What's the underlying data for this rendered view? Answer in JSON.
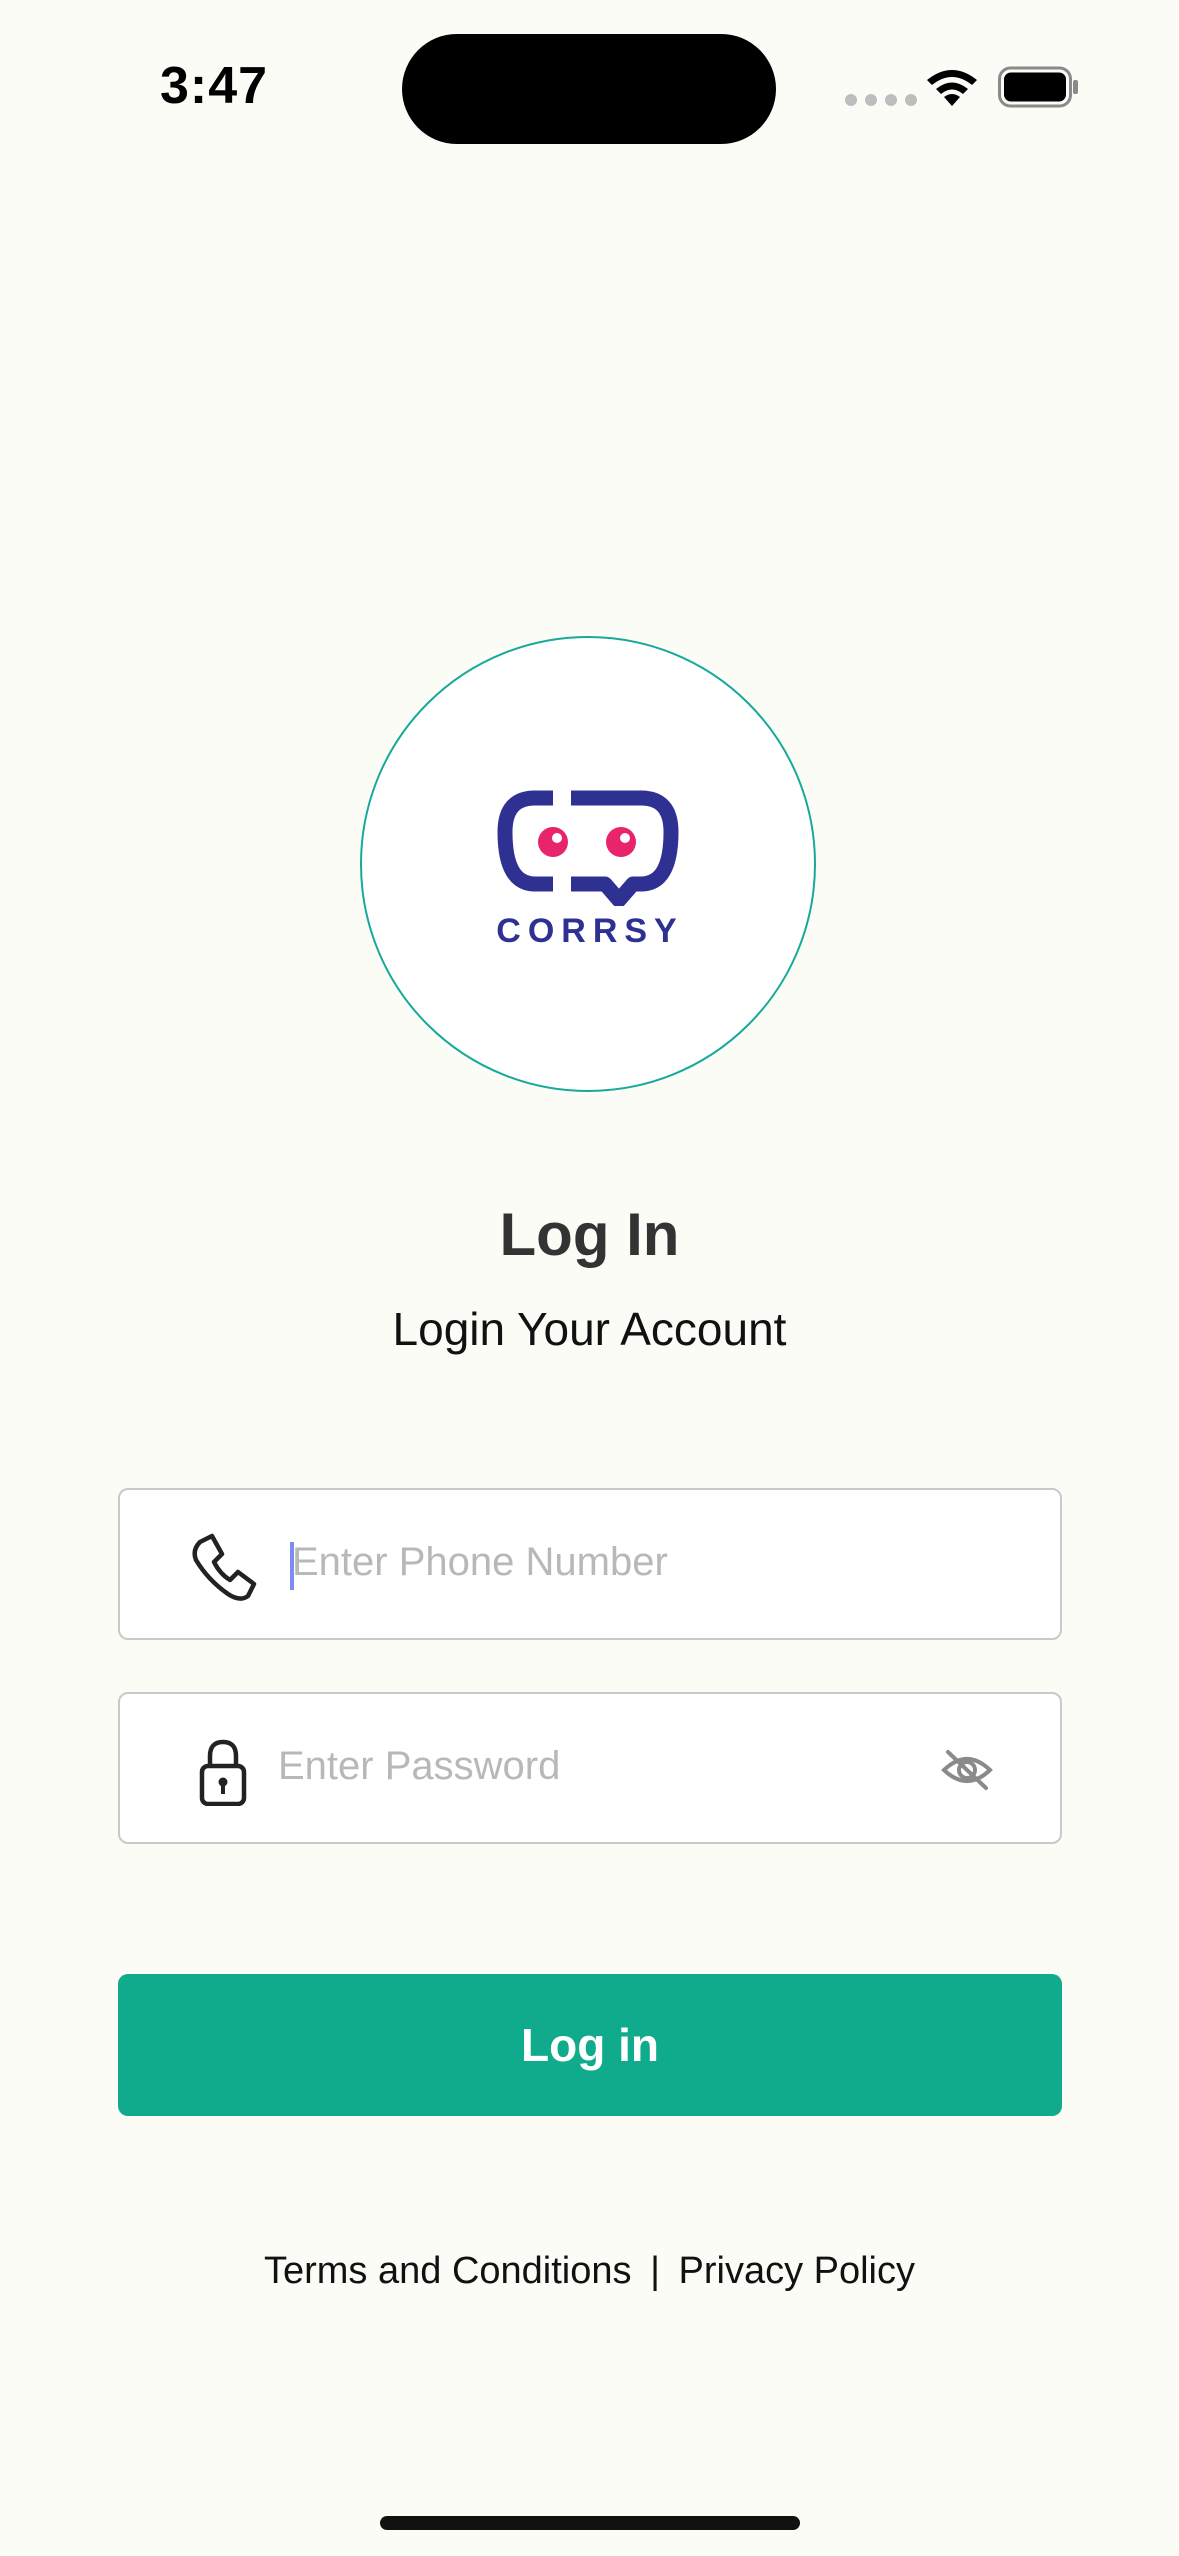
{
  "status_bar": {
    "time": "3:47"
  },
  "logo": {
    "wordmark": "CORRSY",
    "colors": {
      "outline": "#2e3192",
      "eyes": "#e8246b",
      "ring": "#17a99a"
    }
  },
  "header": {
    "title": "Log In",
    "subtitle": "Login Your Account"
  },
  "form": {
    "phone": {
      "placeholder": "Enter Phone Number",
      "value": "",
      "icon": "phone-icon"
    },
    "password": {
      "placeholder": "Enter Password",
      "value": "",
      "icon": "lock-icon",
      "toggle_icon": "eye-slash-icon"
    },
    "submit_label": "Log in"
  },
  "footer": {
    "terms": "Terms and Conditions",
    "separator": "|",
    "privacy": "Privacy Policy"
  },
  "theme": {
    "background": "#fbfcf6",
    "accent": "#10ab8c"
  }
}
